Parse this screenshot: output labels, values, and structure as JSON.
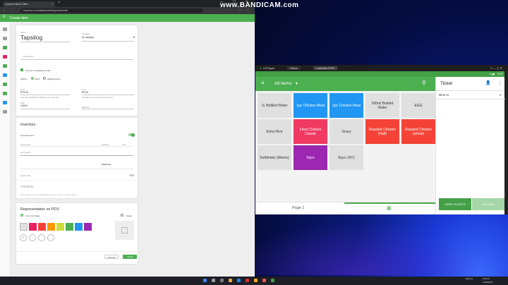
{
  "recorder": {
    "watermark": "www.BANDICAM.com"
  },
  "browser": {
    "tab_title": "Loyverse Back Office",
    "tab_close": "×",
    "new_tab": "+",
    "window_controls": "— ▢ ✕",
    "nav": "← → ↻",
    "url": "r.loyverse.com/dashboard/#/goods/create",
    "extensions": "☆ ⋮"
  },
  "app": {
    "header_title": "Create item",
    "menu_icon": "≡",
    "rail_colors": [
      "#9e9e9e",
      "#9e9e9e",
      "#4caf50",
      "#e91e63",
      "#4caf50",
      "#2196f3",
      "#4caf50",
      "#4caf50",
      "#2196f3",
      "#9e9e9e"
    ]
  },
  "item_form": {
    "name_label": "Name",
    "name_value": "Tapsilog",
    "category_label": "Category",
    "category_value": "No category",
    "description_label": "Description",
    "available_label": "The item is available for sale",
    "sold_by_label": "Sold by",
    "sold_each": "Each",
    "sold_weight": "Weight/Volume",
    "price_label": "Price",
    "price_value": "₱75.00",
    "price_hint": "Leave the field blank to indicate the price upon sale",
    "cost_label": "Cost",
    "cost_value": "₱0.00",
    "sku_label": "SKU",
    "sku_value": "10015",
    "cost_hint": "Calculated as the cost of each component",
    "barcode_label": "Barcode"
  },
  "inventory": {
    "title": "Inventory",
    "composite_label": "Composite item",
    "col_component": "Component",
    "col_quantity": "Quantity",
    "col_cost": "Cost",
    "search_placeholder": "Item search",
    "total_cost": "Total cost",
    "track_stock": "Track stock"
  },
  "variants": {
    "title": "Variants",
    "hint": "Use variants if an item has different sizes, colors or other options"
  },
  "representation": {
    "title": "Representation on POS",
    "color_shape": "Color and shape",
    "image": "Image",
    "swatches": [
      "#e0e0e0",
      "#e91e63",
      "#f44336",
      "#ff9800",
      "#cddc39",
      "#4caf50",
      "#2196f3",
      "#9c27b0"
    ],
    "cancel": "CANCEL",
    "save": "SAVE"
  },
  "emulator": {
    "app_name": "LDPlayer",
    "tab_home": "Home",
    "tab_pos": "Loyverse POS",
    "win_controls": "≡ — ▢ ✕",
    "time": "9:09",
    "status_icons": "▼◢▮",
    "all_items": "All items",
    "menu_icon": "≡",
    "caret": "▾",
    "search_icon": "⚲",
    "items": [
      {
        "label": "1L Bottled Water",
        "color": "#e0e0e0",
        "text": "#333"
      },
      {
        "label": "1pc Chicken Meal",
        "color": "#2196f3",
        "text": "#fff"
      },
      {
        "label": "2pc Chicken Meal",
        "color": "#2196f3",
        "text": "#fff"
      },
      {
        "label": "500ml Bottled Water",
        "color": "#e0e0e0",
        "text": "#333"
      },
      {
        "label": "EGG",
        "color": "#e0e0e0",
        "text": "#333"
      },
      {
        "label": "Extra Rice",
        "color": "#e0e0e0",
        "text": "#333"
      },
      {
        "label": "Fried Chicken Classic",
        "color": "#f03a62",
        "text": "#fff"
      },
      {
        "label": "Gravy",
        "color": "#e0e0e0",
        "text": "#333"
      },
      {
        "label": "Roasted Chicken (Half)",
        "color": "#f44336",
        "text": "#fff"
      },
      {
        "label": "Roasted Chicken (whole)",
        "color": "#f44336",
        "text": "#fff"
      },
      {
        "label": "Softdrinks (Mismo)",
        "color": "#e0e0e0",
        "text": "#333"
      },
      {
        "label": "Styro",
        "color": "#9c27b0",
        "text": "#fff"
      },
      {
        "label": "Styro 2/FC",
        "color": "#e0e0e0",
        "text": "#333"
      }
    ],
    "page_label": "Page 1",
    "grid_icon": "▦",
    "ticket_title": "Ticket",
    "dine_in": "Dine in",
    "open_tickets": "OPEN TICKETS",
    "charge": "CHARGE",
    "accent": "#4caf50"
  },
  "taskbar": {
    "time": "9:09 pm",
    "date": "10/08/2023",
    "lang": "ENG US"
  }
}
